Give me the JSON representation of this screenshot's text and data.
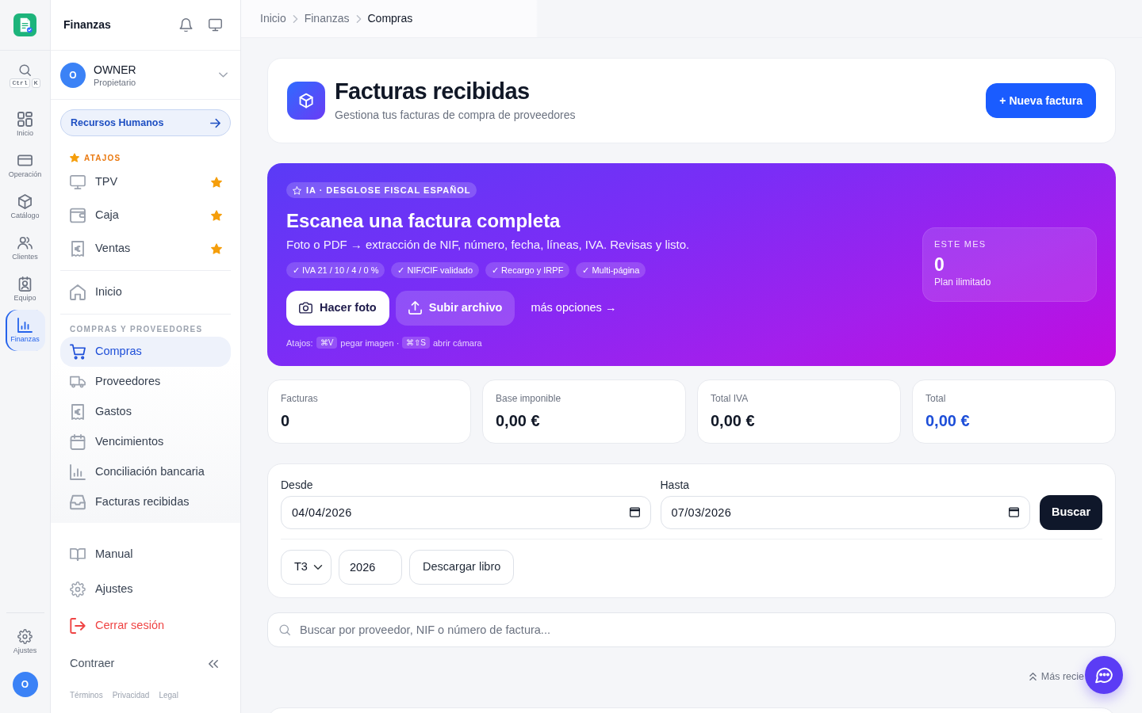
{
  "rail": {
    "search": {
      "keys": [
        "Ctrl",
        "K"
      ]
    },
    "items": [
      {
        "label": "Inicio",
        "selected": false
      },
      {
        "label": "Operación",
        "selected": false
      },
      {
        "label": "Catálogo",
        "selected": false
      },
      {
        "label": "Clientes",
        "selected": false
      },
      {
        "label": "Equipo",
        "selected": false
      },
      {
        "label": "Finanzas",
        "selected": true
      }
    ],
    "settings": "Ajustes",
    "avatar": "O"
  },
  "sidebar": {
    "title": "Finanzas",
    "user": {
      "initial": "O",
      "name": "OWNER",
      "role": "Propietario"
    },
    "module_link": "Recursos Humanos",
    "shortcuts": {
      "heading": "ATAJOS",
      "items": [
        {
          "label": "TPV",
          "starred": true
        },
        {
          "label": "Caja",
          "starred": true
        },
        {
          "label": "Ventas",
          "starred": true
        }
      ]
    },
    "home": "Inicio",
    "section": {
      "heading": "COMPRAS Y PROVEEDORES",
      "items": [
        {
          "label": "Compras",
          "selected": true
        },
        {
          "label": "Proveedores",
          "selected": false
        },
        {
          "label": "Gastos",
          "selected": false
        },
        {
          "label": "Vencimientos",
          "selected": false
        },
        {
          "label": "Conciliación bancaria",
          "selected": false
        },
        {
          "label": "Facturas recibidas",
          "selected": false
        }
      ]
    },
    "footer_items": [
      {
        "label": "Manual",
        "kind": "normal"
      },
      {
        "label": "Ajustes",
        "kind": "normal"
      },
      {
        "label": "Cerrar sesión",
        "kind": "danger"
      }
    ],
    "collapse": "Contraer",
    "legal_links": [
      "Términos",
      "Privacidad",
      "Legal"
    ]
  },
  "breadcrumb": [
    {
      "label": "Inicio",
      "current": false
    },
    {
      "label": "Finanzas",
      "current": false
    },
    {
      "label": "Compras",
      "current": true
    }
  ],
  "page_header": {
    "title": "Facturas recibidas",
    "subtitle": "Gestiona tus facturas de compra de proveedores",
    "action": "+ Nueva factura"
  },
  "scan_banner": {
    "badge": "IA · DESGLOSE FISCAL ESPAÑOL",
    "title": "Escanea una factura completa",
    "subtitle": "Foto o PDF → extracción de NIF, número, fecha, líneas, IVA. Revisas y listo.",
    "features": [
      "✓ IVA 21 / 10 / 4 / 0 %",
      "✓ NIF/CIF validado",
      "✓ Recargo y IRPF",
      "✓ Multi-página"
    ],
    "actions": [
      {
        "label": "Hacer foto",
        "kind": "primary"
      },
      {
        "label": "Subir archivo",
        "kind": "secondary"
      },
      {
        "label": "más opciones →",
        "kind": "link"
      }
    ],
    "hints": {
      "intro": "Atajos:",
      "items": [
        {
          "keys": "⌘V",
          "action": "pegar imagen ·"
        },
        {
          "keys": "⌘⇧S",
          "action": "abrir cámara"
        }
      ]
    },
    "usage": {
      "label": "ESTE MES",
      "value": "0",
      "note": "Plan ilimitado"
    }
  },
  "stats": [
    {
      "label": "Facturas",
      "value": "0",
      "kind": "plain"
    },
    {
      "label": "Base imponible",
      "value": "0,00 €",
      "kind": "plain"
    },
    {
      "label": "Total IVA",
      "value": "0,00 €",
      "kind": "plain"
    },
    {
      "label": "Total",
      "value": "0,00 €",
      "kind": "total"
    }
  ],
  "filters": {
    "from": {
      "label": "Desde",
      "value": "04/04/2026"
    },
    "to": {
      "label": "Hasta",
      "value": "07/03/2026"
    },
    "apply": "Buscar",
    "quarter": "T3",
    "year": "2026",
    "export": "Descargar libro"
  },
  "search": {
    "placeholder": "Buscar por proveedor, NIF o número de factura..."
  },
  "sort": {
    "label": "Más recie"
  }
}
